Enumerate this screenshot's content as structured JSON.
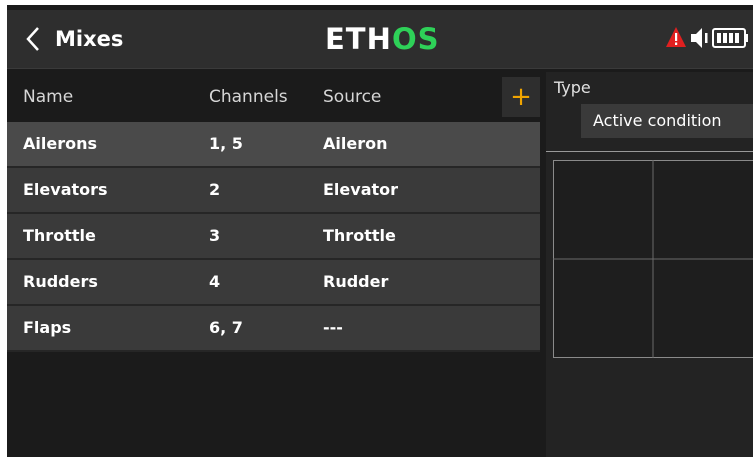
{
  "header": {
    "title": "Mixes",
    "logo_text": "ETHOS"
  },
  "table": {
    "columns": [
      "Name",
      "Channels",
      "Source"
    ],
    "add_label": "+",
    "rows": [
      {
        "name": "Ailerons",
        "channels": "1, 5",
        "source": "Aileron"
      },
      {
        "name": "Elevators",
        "channels": "2",
        "source": "Elevator"
      },
      {
        "name": "Throttle",
        "channels": "3",
        "source": "Throttle"
      },
      {
        "name": "Rudders",
        "channels": "4",
        "source": "Rudder"
      },
      {
        "name": "Flaps",
        "channels": "6, 7",
        "source": "---"
      }
    ]
  },
  "panel": {
    "type_label": "Type",
    "type_value": "Active condition"
  },
  "icons": {
    "back": "back-chevron-icon",
    "warning": "warning-icon",
    "audio": "speaker-icon",
    "battery": "battery-icon"
  },
  "colors": {
    "accent": "#f0a400",
    "logo_green": "#2ed158",
    "warning_red": "#e02020"
  }
}
